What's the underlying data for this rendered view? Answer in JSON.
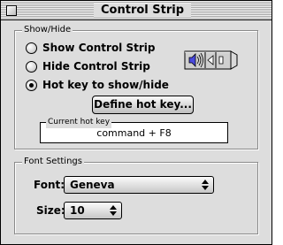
{
  "window": {
    "title": "Control Strip"
  },
  "show_hide": {
    "legend": "Show/Hide",
    "options": [
      {
        "label": "Show Control Strip",
        "selected": false
      },
      {
        "label": "Hide Control Strip",
        "selected": false
      },
      {
        "label": "Hot key to show/hide",
        "selected": true
      }
    ],
    "define_button": "Define hot key...",
    "current_hotkey_label": "Current hot key",
    "current_hotkey_value": "command + F8"
  },
  "font_settings": {
    "legend": "Font Settings",
    "font_label": "Font:",
    "font_value": "Geneva",
    "size_label": "Size:",
    "size_value": "10"
  },
  "icons": [
    "close-box-icon",
    "control-strip-preview-icon",
    "radio-icon",
    "popup-arrows-icon"
  ]
}
